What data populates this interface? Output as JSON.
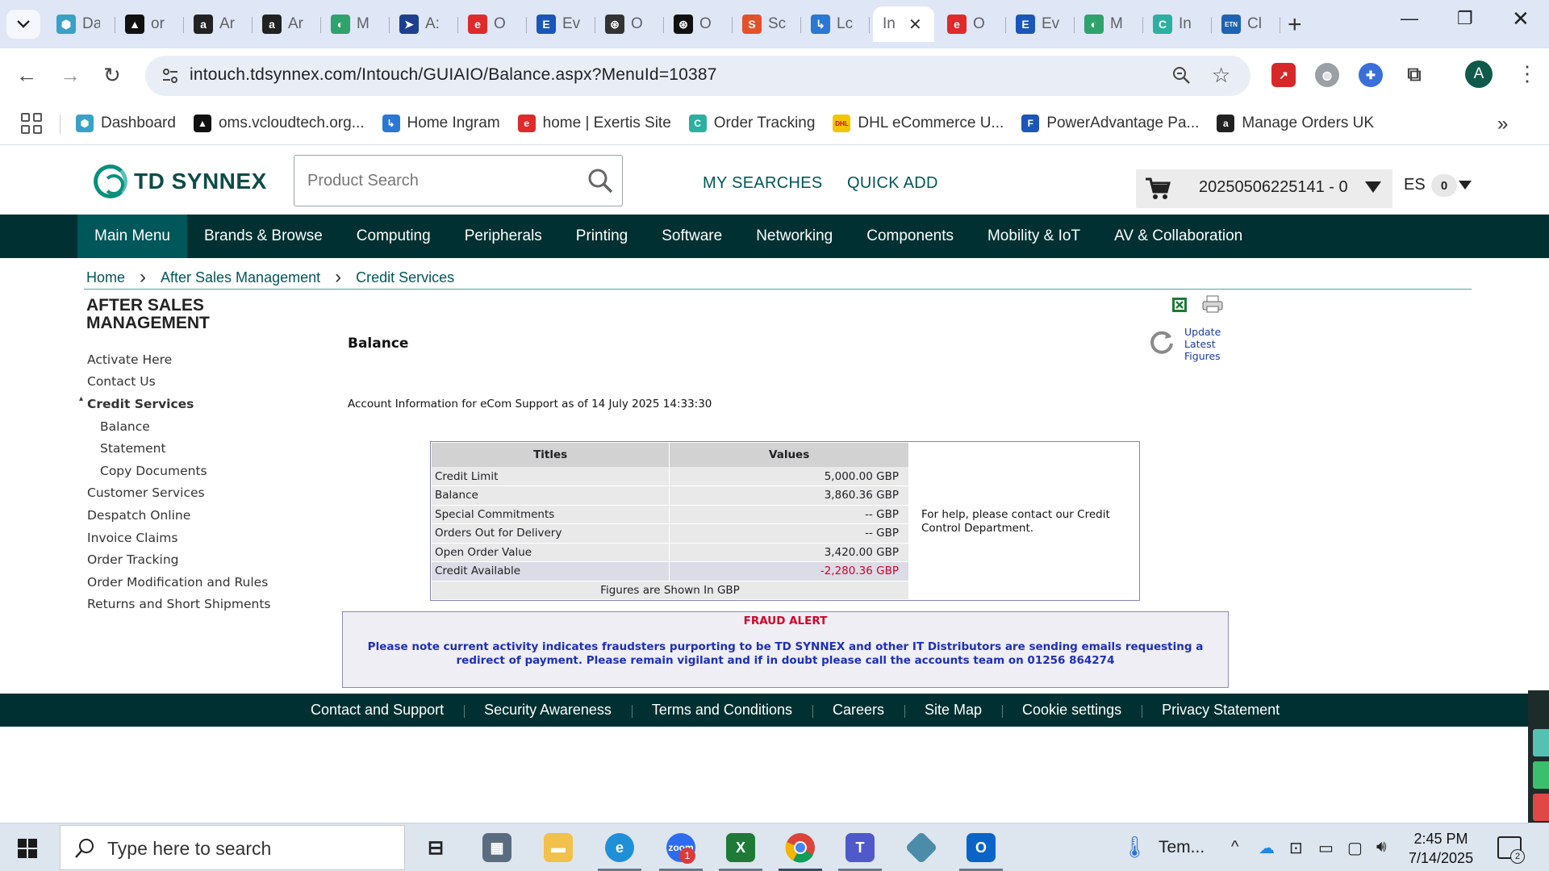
{
  "browser": {
    "tabs": [
      {
        "title": "Da",
        "fav_color": "#3aa1c6",
        "fav_text": "⬢"
      },
      {
        "title": "or",
        "fav_color": "#111111",
        "fav_text": "▲"
      },
      {
        "title": "Ar",
        "fav_color": "#222222",
        "fav_text": "a"
      },
      {
        "title": "Ar",
        "fav_color": "#222222",
        "fav_text": "a"
      },
      {
        "title": "M",
        "fav_color": "#2fa36b",
        "fav_text": "◐"
      },
      {
        "title": "A:",
        "fav_color": "#1d3f8c",
        "fav_text": "➤"
      },
      {
        "title": "O",
        "fav_color": "#e02a2a",
        "fav_text": "e"
      },
      {
        "title": "Ev",
        "fav_color": "#1a56b8",
        "fav_text": "E"
      },
      {
        "title": "O",
        "fav_color": "#333333",
        "fav_text": "⊛"
      },
      {
        "title": "O",
        "fav_color": "#111111",
        "fav_text": "⊛"
      },
      {
        "title": "Sc",
        "fav_color": "#e3512a",
        "fav_text": "S"
      },
      {
        "title": "Lc",
        "fav_color": "#2a77d4",
        "fav_text": "↳"
      },
      {
        "title": "In",
        "fav_color": "#ffffff",
        "fav_text": "",
        "active": true
      },
      {
        "title": "O",
        "fav_color": "#e02a2a",
        "fav_text": "e"
      },
      {
        "title": "Ev",
        "fav_color": "#1a56b8",
        "fav_text": "E"
      },
      {
        "title": "M",
        "fav_color": "#2fa36b",
        "fav_text": "◐"
      },
      {
        "title": "In",
        "fav_color": "#2bb0a2",
        "fav_text": "C"
      },
      {
        "title": "Cl",
        "fav_color": "#1d63b3",
        "fav_text": "ETN"
      }
    ],
    "url_host": "intouch.tdsynnex.com",
    "url_path": "/Intouch/GUIAIO/Balance.aspx?MenuId=10387",
    "profile_initial": "A",
    "bookmarks": [
      {
        "label": "Dashboard",
        "color": "#3aa1c6",
        "glyph": "⬢"
      },
      {
        "label": "oms.vcloudtech.org...",
        "color": "#111111",
        "glyph": "▲"
      },
      {
        "label": "Home Ingram",
        "color": "#2a77d4",
        "glyph": "↳"
      },
      {
        "label": "home | Exertis Site",
        "color": "#e02a2a",
        "glyph": "e"
      },
      {
        "label": "Order Tracking",
        "color": "#2bb0a2",
        "glyph": "C"
      },
      {
        "label": "DHL eCommerce U...",
        "color": "#f5c400",
        "glyph": "DHL"
      },
      {
        "label": "PowerAdvantage Pa...",
        "color": "#1a56b8",
        "glyph": "F"
      },
      {
        "label": "Manage Orders UK",
        "color": "#222222",
        "glyph": "a"
      }
    ]
  },
  "site": {
    "logo_text": "TD SYNNEX",
    "search_placeholder": "Product Search",
    "my_searches": "MY SEARCHES",
    "quick_add": "QUICK ADD",
    "cart_label": "20250506225141 - 0",
    "language": "ES",
    "language_count": "0",
    "nav": [
      "Main Menu",
      "Brands & Browse",
      "Computing",
      "Peripherals",
      "Printing",
      "Software",
      "Networking",
      "Components",
      "Mobility & IoT",
      "AV & Collaboration"
    ],
    "breadcrumb": [
      "Home",
      "After Sales Management",
      "Credit Services"
    ]
  },
  "sidebar": {
    "title": "AFTER SALES MANAGEMENT",
    "items": [
      {
        "label": "Activate Here",
        "level": 0
      },
      {
        "label": "Contact Us",
        "level": 0
      },
      {
        "label": "Credit Services",
        "level": 0,
        "expanded": true
      },
      {
        "label": "Balance",
        "level": 1
      },
      {
        "label": "Statement",
        "level": 1
      },
      {
        "label": "Copy Documents",
        "level": 1
      },
      {
        "label": "Customer Services",
        "level": 0
      },
      {
        "label": "Despatch Online",
        "level": 0
      },
      {
        "label": "Invoice Claims",
        "level": 0
      },
      {
        "label": "Order Tracking",
        "level": 0
      },
      {
        "label": "Order Modification and Rules",
        "level": 0
      },
      {
        "label": "Returns and Short Shipments",
        "level": 0
      }
    ]
  },
  "main": {
    "heading": "Balance",
    "update_text": "Update\nLatest\nFigures",
    "account_info": "Account Information for eCom Support as of 14 July 2025 14:33:30",
    "table": {
      "headers": [
        "Titles",
        "Values"
      ],
      "rows": [
        {
          "title": "Credit Limit",
          "value": "5,000.00 GBP"
        },
        {
          "title": "Balance",
          "value": "3,860.36 GBP"
        },
        {
          "title": "Special Commitments",
          "value": "-- GBP"
        },
        {
          "title": "Orders Out for Delivery",
          "value": "-- GBP"
        },
        {
          "title": "Open Order Value",
          "value": "3,420.00 GBP"
        },
        {
          "title": "Credit Available",
          "value": "-2,280.36 GBP",
          "negative": true
        }
      ],
      "footnote": "Figures are Shown In GBP"
    },
    "help_text": "For help, please contact our Credit Control Department.",
    "fraud_title": "FRAUD ALERT",
    "fraud_message": "Please note current activity indicates fraudsters purporting to be TD SYNNEX and other IT Distributors are sending emails requesting a redirect of payment. Please remain vigilant and if in doubt please call the accounts team on 01256 864274"
  },
  "footer": [
    "Contact and Support",
    "Security Awareness",
    "Terms and Conditions",
    "Careers",
    "Site Map",
    "Cookie settings",
    "Privacy Statement"
  ],
  "taskbar": {
    "search_placeholder": "Type here to search",
    "weather": "Tem...",
    "time": "2:45 PM",
    "date": "7/14/2025",
    "zoom_badge": "1",
    "notif_count": "2"
  }
}
